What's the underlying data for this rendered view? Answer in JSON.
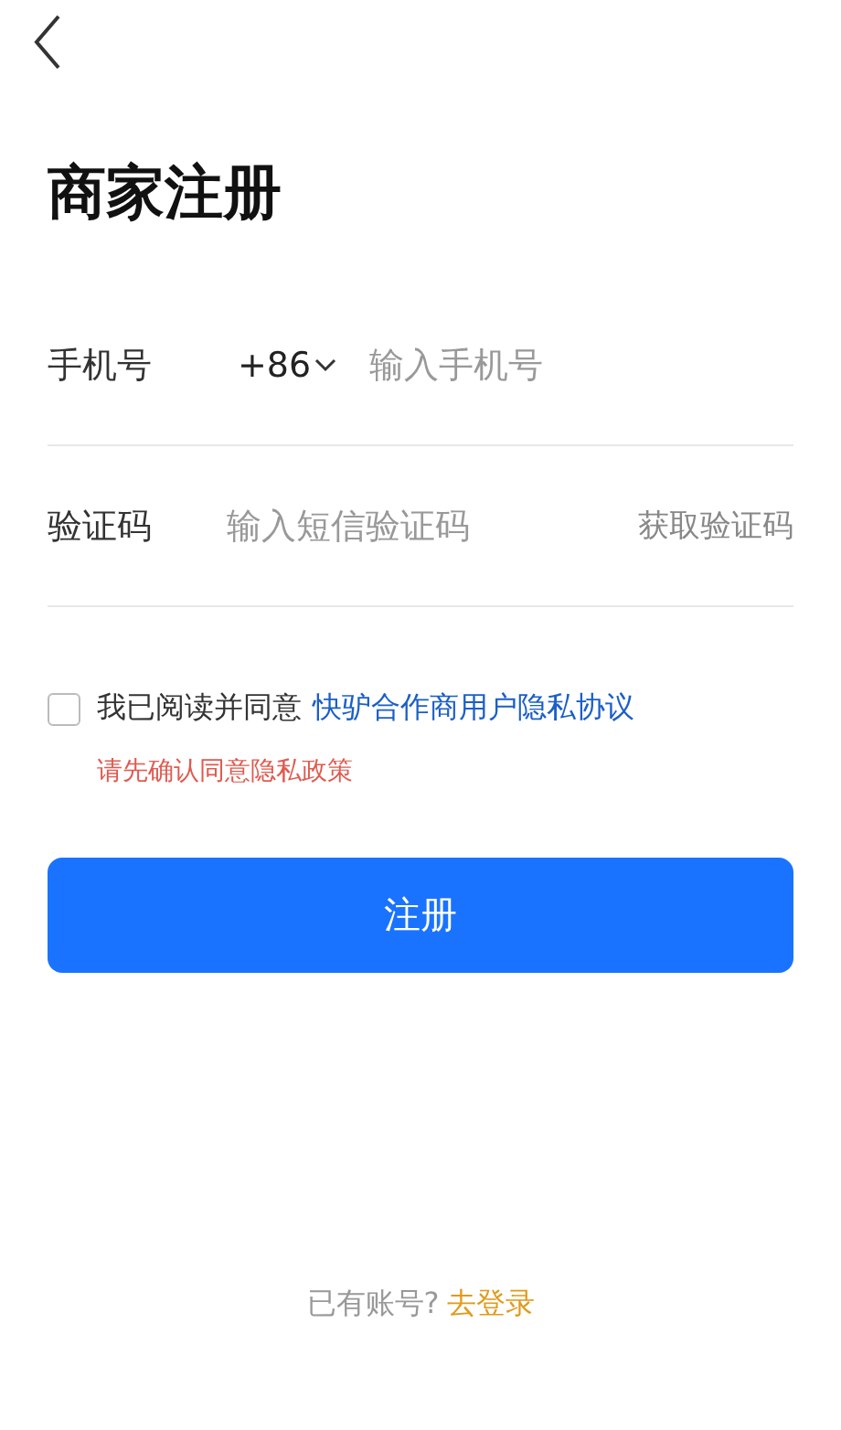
{
  "title": "商家注册",
  "phone": {
    "label": "手机号",
    "country_code": "+86",
    "placeholder": "输入手机号"
  },
  "code": {
    "label": "验证码",
    "placeholder": "输入短信验证码",
    "get_code": "获取验证码"
  },
  "agreement": {
    "checked": false,
    "text": "我已阅读并同意",
    "link": "快驴合作商用户隐私协议",
    "error": "请先确认同意隐私政策"
  },
  "submit": "注册",
  "footer": {
    "text": "已有账号?",
    "link": "去登录"
  }
}
